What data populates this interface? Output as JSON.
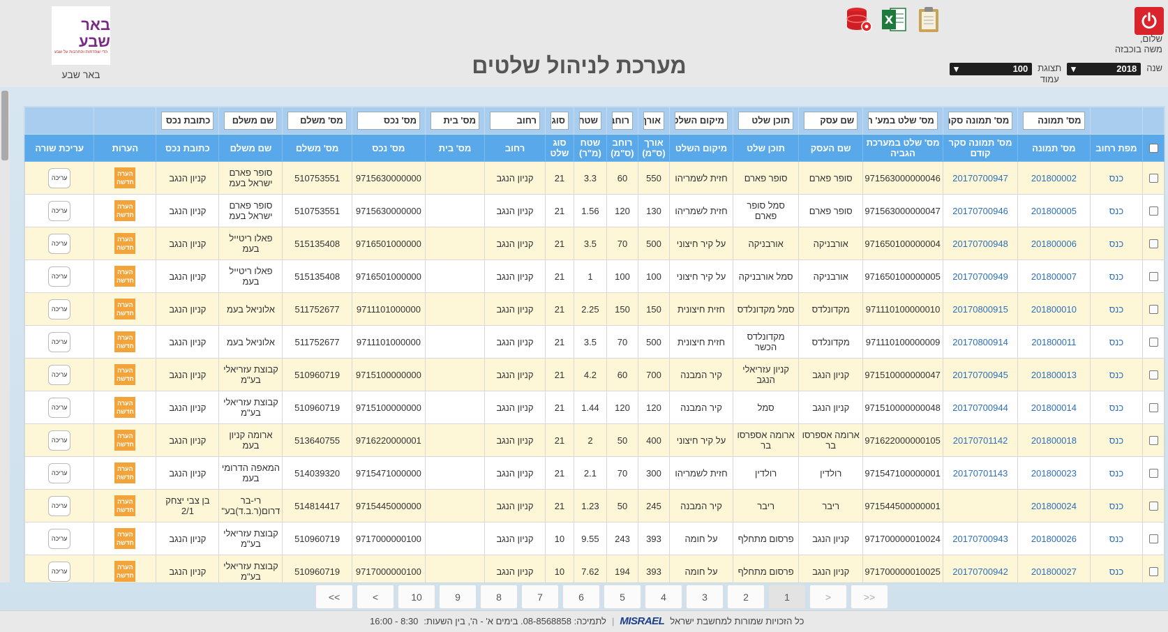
{
  "header": {
    "greeting": "שלום,",
    "user_name": "משה בוכבזה",
    "title": "מערכת לניהול שלטים",
    "city": "באר שבע",
    "logo_text": "באר שבע",
    "logo_sub": "הדי שהדתות והתרבות על שבע"
  },
  "filters": {
    "year_label": "שנה",
    "year_value": "2018",
    "page_size_label": "תצוגת עמוד",
    "page_size_label_1": "תצוגת",
    "page_size_label_2": "עמוד",
    "page_size_value": "100"
  },
  "icons": [
    "power-icon",
    "database-settings-icon",
    "excel-icon",
    "clipboard-icon"
  ],
  "columns": [
    {
      "key": "map",
      "header": "מפת רחוב",
      "filter": ""
    },
    {
      "key": "pic",
      "header": "מס' תמונה",
      "filter": "מס' תמונה"
    },
    {
      "key": "prev",
      "header": "מס' תמונה סקר קודם",
      "filter": "מס' תמונה סקר ק"
    },
    {
      "key": "sign_no",
      "header": "מס' שלט במערכת הגביה",
      "filter": "מס' שלט במע' הגב"
    },
    {
      "key": "business",
      "header": "שם העסק",
      "filter": "שם עסק"
    },
    {
      "key": "content",
      "header": "תוכן שלט",
      "filter": "תוכן שלט"
    },
    {
      "key": "location",
      "header": "מיקום השלט",
      "filter": "מיקום השלט"
    },
    {
      "key": "length",
      "header": "אורך (ס\"מ)",
      "filter": "אורך"
    },
    {
      "key": "width",
      "header": "רוחב (ס\"מ)",
      "filter": "רוחב"
    },
    {
      "key": "area",
      "header": "שטח (מ\"ר)",
      "filter": "שטח"
    },
    {
      "key": "type",
      "header": "סוג שלט",
      "filter": "סוג של"
    },
    {
      "key": "street",
      "header": "רחוב",
      "filter": "רחוב"
    },
    {
      "key": "house",
      "header": "מס' בית",
      "filter": "מס' בית"
    },
    {
      "key": "asset",
      "header": "מס' נכס",
      "filter": "מס' נכס"
    },
    {
      "key": "payer_no",
      "header": "מס' משלם",
      "filter": "מס' משלם"
    },
    {
      "key": "payer",
      "header": "שם משלם",
      "filter": "שם משלם"
    },
    {
      "key": "asset_addr",
      "header": "כתובת נכס",
      "filter": "כתובת נכס"
    },
    {
      "key": "notes",
      "header": "הערות",
      "filter": ""
    },
    {
      "key": "edit",
      "header": "עריכת שורה",
      "filter": ""
    }
  ],
  "row_buttons": {
    "map_link": "כנס",
    "note": "הערה חדשה",
    "note_1": "הערה",
    "note_2": "חדשה",
    "edit": "עריכה"
  },
  "rows": [
    {
      "pic": "201800002",
      "prev": "20170700947",
      "sign_no": "971563000000046",
      "business": "סופר פארם",
      "content": "סופר פארם",
      "location": "חזית לשמריהו",
      "length": "550",
      "width": "60",
      "area": "3.3",
      "type": "21",
      "street": "קניון הנגב",
      "house": "",
      "asset": "9715630000000",
      "payer_no": "510753551",
      "payer": "סופר פארם ישראל בעמ",
      "asset_addr": "קניון הנגב"
    },
    {
      "pic": "201800005",
      "prev": "20170700946",
      "sign_no": "971563000000047",
      "business": "סופר פארם",
      "content": "סמל סופר פארם",
      "location": "חזית לשמריהו",
      "length": "130",
      "width": "120",
      "area": "1.56",
      "type": "21",
      "street": "קניון הנגב",
      "house": "",
      "asset": "9715630000000",
      "payer_no": "510753551",
      "payer": "סופר פארם ישראל בעמ",
      "asset_addr": "קניון הנגב"
    },
    {
      "pic": "201800006",
      "prev": "20170700948",
      "sign_no": "971650100000004",
      "business": "אורבניקה",
      "content": "אורבניקה",
      "location": "על קיר חיצוני",
      "length": "500",
      "width": "70",
      "area": "3.5",
      "type": "21",
      "street": "קניון הנגב",
      "house": "",
      "asset": "9716501000000",
      "payer_no": "515135408",
      "payer": "פאלו ריטייל בעמ",
      "asset_addr": "קניון הנגב"
    },
    {
      "pic": "201800007",
      "prev": "20170700949",
      "sign_no": "971650100000005",
      "business": "אורבניקה",
      "content": "סמל אורבניקה",
      "location": "על קיר חיצוני",
      "length": "100",
      "width": "100",
      "area": "1",
      "type": "21",
      "street": "קניון הנגב",
      "house": "",
      "asset": "9716501000000",
      "payer_no": "515135408",
      "payer": "פאלו ריטייל בעמ",
      "asset_addr": "קניון הנגב"
    },
    {
      "pic": "201800010",
      "prev": "20170800915",
      "sign_no": "971110100000010",
      "business": "מקדונלדס",
      "content": "סמל מקדונלדס",
      "location": "חזית חיצונית",
      "length": "150",
      "width": "150",
      "area": "2.25",
      "type": "21",
      "street": "קניון הנגב",
      "house": "",
      "asset": "9711101000000",
      "payer_no": "511752677",
      "payer": "אלוניאל בעמ",
      "asset_addr": "קניון הנגב"
    },
    {
      "pic": "201800011",
      "prev": "20170800914",
      "sign_no": "971110100000009",
      "business": "מקדונלדס",
      "content": "מקדונלדס הכשר",
      "location": "חזית חיצונית",
      "length": "500",
      "width": "70",
      "area": "3.5",
      "type": "21",
      "street": "קניון הנגב",
      "house": "",
      "asset": "9711101000000",
      "payer_no": "511752677",
      "payer": "אלוניאל בעמ",
      "asset_addr": "קניון הנגב"
    },
    {
      "pic": "201800013",
      "prev": "20170700945",
      "sign_no": "971510000000047",
      "business": "קניון הנגב",
      "content": "קניון עזריאלי הנגב",
      "location": "קיר המבנה",
      "length": "700",
      "width": "60",
      "area": "4.2",
      "type": "21",
      "street": "קניון הנגב",
      "house": "",
      "asset": "9715100000000",
      "payer_no": "510960719",
      "payer": "קבוצת עזריאלי בע\"מ",
      "asset_addr": "קניון הנגב"
    },
    {
      "pic": "201800014",
      "prev": "20170700944",
      "sign_no": "971510000000048",
      "business": "קניון הנגב",
      "content": "סמל",
      "location": "קיר המבנה",
      "length": "120",
      "width": "120",
      "area": "1.44",
      "type": "21",
      "street": "קניון הנגב",
      "house": "",
      "asset": "9715100000000",
      "payer_no": "510960719",
      "payer": "קבוצת עזריאלי בע\"מ",
      "asset_addr": "קניון הנגב"
    },
    {
      "pic": "201800018",
      "prev": "20170701142",
      "sign_no": "971622000000105",
      "business": "ארומה אספרסו בר",
      "content": "ארומה אספרסו בר",
      "location": "על קיר חיצוני",
      "length": "400",
      "width": "50",
      "area": "2",
      "type": "21",
      "street": "קניון הנגב",
      "house": "",
      "asset": "9716220000001",
      "payer_no": "513640755",
      "payer": "ארומה קניון בעמ",
      "asset_addr": "קניון הנגב"
    },
    {
      "pic": "201800023",
      "prev": "20170701143",
      "sign_no": "971547100000001",
      "business": "רולדין",
      "content": "רולדין",
      "location": "חזית לשמריהו",
      "length": "300",
      "width": "70",
      "area": "2.1",
      "type": "21",
      "street": "קניון הנגב",
      "house": "",
      "asset": "9715471000000",
      "payer_no": "514039320",
      "payer": "המאפה הדרומי בעמ",
      "asset_addr": "קניון הנגב"
    },
    {
      "pic": "201800024",
      "prev": "",
      "sign_no": "971544500000001",
      "business": "ריבר",
      "content": "ריבר",
      "location": "קיר המבנה",
      "length": "245",
      "width": "50",
      "area": "1.23",
      "type": "21",
      "street": "קניון הנגב",
      "house": "",
      "asset": "9715445000000",
      "payer_no": "514814417",
      "payer": "רי-בר דרום(ר.ב.ד)בע\"",
      "asset_addr": "בן צבי יצחק 2/1"
    },
    {
      "pic": "201800026",
      "prev": "20170700943",
      "sign_no": "971700000010024",
      "business": "קניון הנגב",
      "content": "פרסום מתחלף",
      "location": "על חומה",
      "length": "393",
      "width": "243",
      "area": "9.55",
      "type": "10",
      "street": "קניון הנגב",
      "house": "",
      "asset": "9717000000100",
      "payer_no": "510960719",
      "payer": "קבוצת עזריאלי בע\"מ",
      "asset_addr": "קניון הנגב"
    },
    {
      "pic": "201800027",
      "prev": "20170700942",
      "sign_no": "971700000010025",
      "business": "קניון הנגב",
      "content": "פרסום מתחלף",
      "location": "על חומה",
      "length": "393",
      "width": "194",
      "area": "7.62",
      "type": "10",
      "street": "קניון הנגב",
      "house": "",
      "asset": "9717000000100",
      "payer_no": "510960719",
      "payer": "קבוצת עזריאלי בע\"מ",
      "asset_addr": "קניון הנגב"
    }
  ],
  "pagination": {
    "buttons": [
      "<<",
      "<",
      "10",
      "9",
      "8",
      "7",
      "6",
      "5",
      "4",
      "3",
      "2",
      "1",
      ">",
      ">>"
    ],
    "active": "1"
  },
  "footer": {
    "rights": "כל הזכויות שמורות למחשבת ישראל",
    "brand": "MISRAEL",
    "support": "לתמיכה: 08-8568858. בימים א' - ה', בין השעות:",
    "hours": "8:30 - 16:00"
  }
}
